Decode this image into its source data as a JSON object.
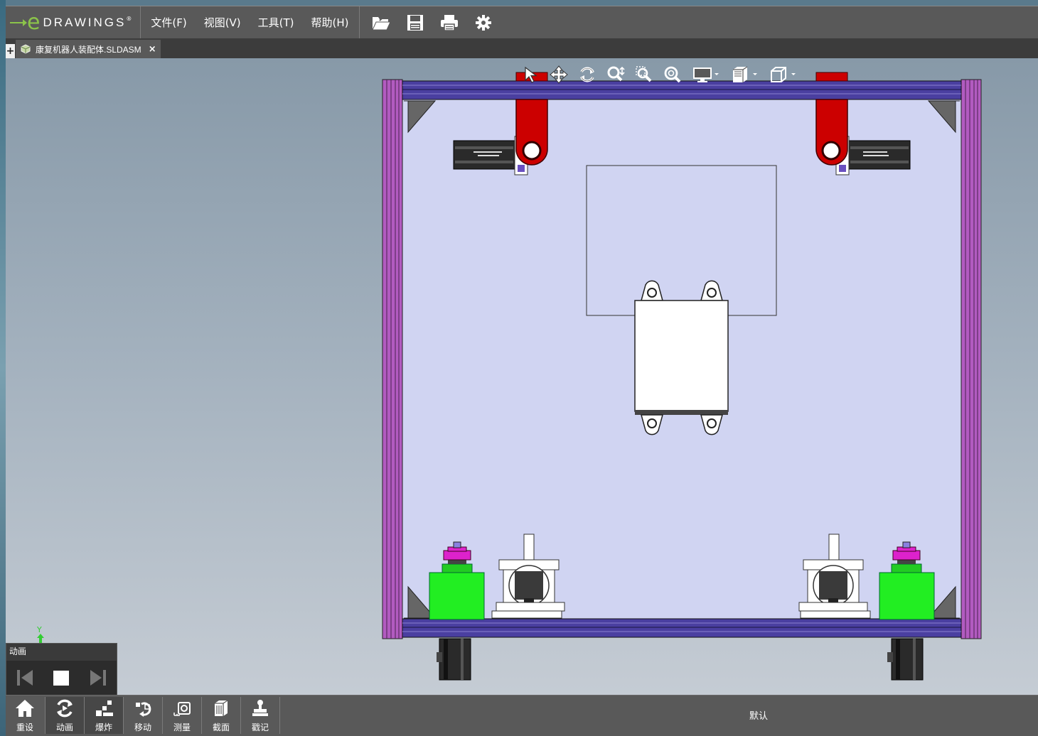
{
  "app": {
    "logo_text": "DRAWINGS",
    "logo_letter": "e",
    "logo_mark": "®"
  },
  "menu": {
    "items": [
      {
        "label": "文件(F)"
      },
      {
        "label": "视图(V)"
      },
      {
        "label": "工具(T)"
      },
      {
        "label": "帮助(H)"
      }
    ]
  },
  "top_toolbar": [
    {
      "icon": "open-folder-icon"
    },
    {
      "icon": "save-icon"
    },
    {
      "icon": "print-icon"
    },
    {
      "icon": "settings-gear-icon"
    }
  ],
  "tab": {
    "add_label": "+",
    "document_name": "康复机器人装配体.SLDASM",
    "close_label": "×"
  },
  "view_toolbar": [
    {
      "icon": "select-arrow-icon"
    },
    {
      "icon": "pan-icon"
    },
    {
      "icon": "rotate-icon"
    },
    {
      "icon": "zoom-icon"
    },
    {
      "icon": "zoom-to-area-icon"
    },
    {
      "icon": "zoom-to-fit-icon"
    },
    {
      "icon": "display-style-icon"
    },
    {
      "icon": "section-view-icon"
    },
    {
      "icon": "standard-views-icon"
    }
  ],
  "triad": {
    "y_label": "Y"
  },
  "animation_panel": {
    "title": "动画",
    "controls": [
      "previous-step-icon",
      "stop-icon",
      "next-step-icon"
    ]
  },
  "bottom_toolbar": [
    {
      "label": "重设",
      "icon": "home-icon",
      "active": false
    },
    {
      "label": "动画",
      "icon": "animate-icon",
      "active": true
    },
    {
      "label": "爆炸",
      "icon": "explode-icon",
      "active": true
    },
    {
      "label": "移动",
      "icon": "move-icon",
      "active": false
    },
    {
      "label": "测量",
      "icon": "measure-icon",
      "active": false
    },
    {
      "label": "截面",
      "icon": "section-icon",
      "active": false
    },
    {
      "label": "戳记",
      "icon": "stamp-icon",
      "active": false
    }
  ],
  "configuration": {
    "label": "默认"
  },
  "colors": {
    "frame_purple": "#b25bc0",
    "rail_blue": "#4a3fa0",
    "part_red": "#cc0000",
    "part_green": "#22ee22",
    "part_magenta": "#dd22cc",
    "model_bg": "#d0d4f2",
    "ui_dark": "#595959"
  }
}
